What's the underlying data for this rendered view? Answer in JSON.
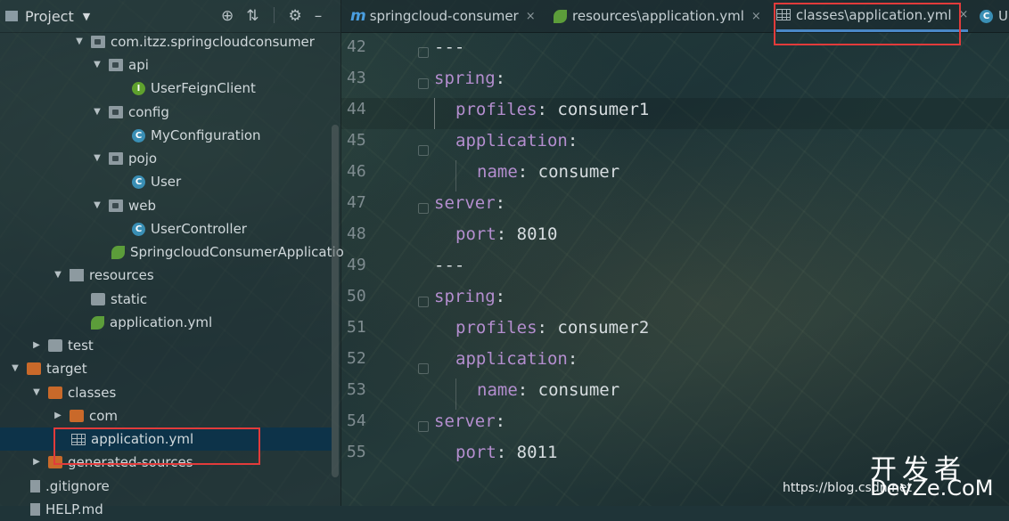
{
  "project_panel": {
    "title": "Project",
    "tree": [
      {
        "label": "com.itzz.springcloudconsumer",
        "icon": "package-icon",
        "expanded": true
      },
      {
        "label": "api",
        "icon": "package-icon",
        "expanded": true
      },
      {
        "label": "UserFeignClient",
        "icon": "interface-icon",
        "badge": "I"
      },
      {
        "label": "config",
        "icon": "package-icon",
        "expanded": true
      },
      {
        "label": "MyConfiguration",
        "icon": "class-icon",
        "badge": "C"
      },
      {
        "label": "pojo",
        "icon": "package-icon",
        "expanded": true
      },
      {
        "label": "User",
        "icon": "class-icon",
        "badge": "C"
      },
      {
        "label": "web",
        "icon": "package-icon",
        "expanded": true
      },
      {
        "label": "UserController",
        "icon": "class-icon",
        "badge": "C"
      },
      {
        "label": "SpringcloudConsumerApplicatio",
        "icon": "spring-class-icon"
      },
      {
        "label": "resources",
        "icon": "resources-folder-icon",
        "expanded": true
      },
      {
        "label": "static",
        "icon": "folder-icon"
      },
      {
        "label": "application.yml",
        "icon": "spring-yml-icon"
      },
      {
        "label": "test",
        "icon": "folder-icon",
        "expanded": false
      },
      {
        "label": "target",
        "icon": "orange-folder-icon",
        "expanded": true
      },
      {
        "label": "classes",
        "icon": "orange-folder-icon",
        "expanded": true
      },
      {
        "label": "com",
        "icon": "orange-folder-icon",
        "expanded": false
      },
      {
        "label": "application.yml",
        "icon": "yml-table-icon",
        "selected": true
      },
      {
        "label": "generated-sources",
        "icon": "orange-folder-icon",
        "expanded": false
      },
      {
        "label": ".gitignore",
        "icon": "file-icon"
      },
      {
        "label": "HELP.md",
        "icon": "file-icon"
      }
    ]
  },
  "tabs": [
    {
      "label": "springcloud-consumer",
      "icon": "maven-icon",
      "close": "×"
    },
    {
      "label": "resources\\application.yml",
      "icon": "spring-yml-icon",
      "close": "×"
    },
    {
      "label": "classes\\application.yml",
      "icon": "yml-table-icon",
      "close": "×",
      "active": true
    },
    {
      "label": "U",
      "icon": "class-icon"
    }
  ],
  "editor": {
    "lines": [
      {
        "num": "42",
        "key": "",
        "sep": "",
        "val": "---",
        "indent": 0
      },
      {
        "num": "43",
        "key": "spring",
        "sep": ":",
        "val": "",
        "indent": 0
      },
      {
        "num": "44",
        "key": "profiles",
        "sep": ":",
        "val": " consumer1",
        "indent": 1
      },
      {
        "num": "45",
        "key": "application",
        "sep": ":",
        "val": "",
        "indent": 1
      },
      {
        "num": "46",
        "key": "name",
        "sep": ":",
        "val": " consumer",
        "indent": 2
      },
      {
        "num": "47",
        "key": "server",
        "sep": ":",
        "val": "",
        "indent": 0
      },
      {
        "num": "48",
        "key": "port",
        "sep": ":",
        "val": " 8010",
        "indent": 1
      },
      {
        "num": "49",
        "key": "",
        "sep": "",
        "val": "---",
        "indent": 0
      },
      {
        "num": "50",
        "key": "spring",
        "sep": ":",
        "val": "",
        "indent": 0
      },
      {
        "num": "51",
        "key": "profiles",
        "sep": ":",
        "val": " consumer2",
        "indent": 1
      },
      {
        "num": "52",
        "key": "application",
        "sep": ":",
        "val": "",
        "indent": 1
      },
      {
        "num": "53",
        "key": "name",
        "sep": ":",
        "val": " consumer",
        "indent": 2
      },
      {
        "num": "54",
        "key": "server",
        "sep": ":",
        "val": "",
        "indent": 0
      },
      {
        "num": "55",
        "key": "port",
        "sep": ":",
        "val": " 8011",
        "indent": 1
      }
    ]
  },
  "watermark": {
    "url": "https://blog.csdn.net",
    "cn": "开发者",
    "brand": "DevZe.CoM"
  },
  "colors": {
    "key": "#b48ecf",
    "highlight": "#e23b3b",
    "selection": "#0d3349"
  }
}
